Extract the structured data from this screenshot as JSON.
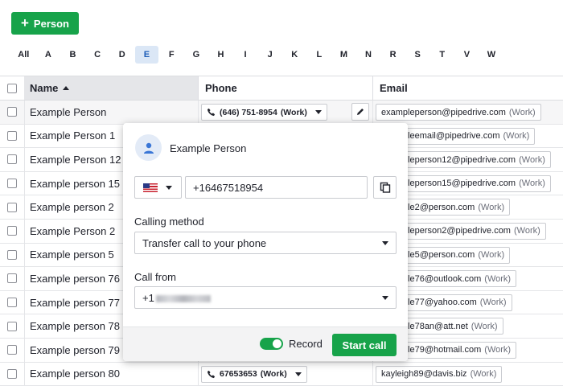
{
  "toolbar": {
    "add_label": "Person"
  },
  "alphabet": {
    "letters": [
      "All",
      "A",
      "B",
      "C",
      "D",
      "E",
      "F",
      "G",
      "H",
      "I",
      "J",
      "K",
      "L",
      "M",
      "N",
      "R",
      "S",
      "T",
      "V",
      "W"
    ],
    "active": "E"
  },
  "table": {
    "headers": {
      "name": "Name",
      "phone": "Phone",
      "email": "Email"
    },
    "rows": [
      {
        "name": "Example Person",
        "phone": "(646) 751-8954",
        "phone_type": "(Work)",
        "email": "exampleperson@pipedrive.com",
        "email_type": "(Work)"
      },
      {
        "name": "Example Person 1",
        "email": "exampleemail@pipedrive.com",
        "email_type": "(Work)"
      },
      {
        "name": "Example Person 12",
        "email": "exampleperson12@pipedrive.com",
        "email_type": "(Work)"
      },
      {
        "name": "Example person 15",
        "email": "exampleperson15@pipedrive.com",
        "email_type": "(Work)"
      },
      {
        "name": "Example person 2",
        "email": "example2@person.com",
        "email_type": "(Work)"
      },
      {
        "name": "Example Person 2",
        "email": "exampleperson2@pipedrive.com",
        "email_type": "(Work)"
      },
      {
        "name": "Example person 5",
        "email": "example5@person.com",
        "email_type": "(Work)"
      },
      {
        "name": "Example person 76",
        "email": "example76@outlook.com",
        "email_type": "(Work)"
      },
      {
        "name": "Example person 77",
        "email": "example77@yahoo.com",
        "email_type": "(Work)"
      },
      {
        "name": "Example person 78",
        "email": "example78an@att.net",
        "email_type": "(Work)"
      },
      {
        "name": "Example person 79",
        "email": "example79@hotmail.com",
        "email_type": "(Work)"
      },
      {
        "name": "Example person 80",
        "phone": "67653653",
        "phone_type": "(Work)",
        "email": "kayleigh89@davis.biz",
        "email_type": "(Work)"
      }
    ]
  },
  "popover": {
    "person_name": "Example Person",
    "phone_value": "+16467518954",
    "calling_method_label": "Calling method",
    "calling_method_value": "Transfer call to your phone",
    "call_from_label": "Call from",
    "call_from_value": "+1",
    "record_label": "Record",
    "record_on": true,
    "start_call_label": "Start call"
  },
  "colors": {
    "accent": "#17a34a",
    "active_letter_bg": "#dbe7f6",
    "header_sorted_bg": "#e5e6e9"
  }
}
